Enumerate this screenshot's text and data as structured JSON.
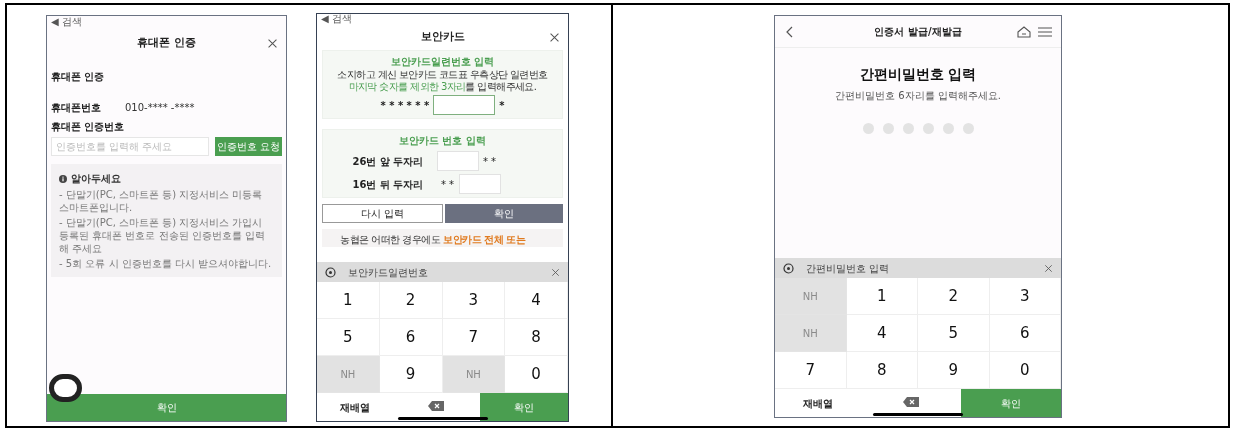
{
  "phone_verification": {
    "status_bar": "◀ 검색",
    "title": "휴대폰 인증",
    "section_title": "휴대폰 인증",
    "phone_label": "휴대폰번호",
    "phone_value": "010-**** -****",
    "code_label": "휴대폰 인증번호",
    "code_field": {
      "placeholder": "인증번호를 입력해 주세요"
    },
    "request_button": "인증번호 요청",
    "notice": {
      "title": "알아두세요",
      "items": [
        "- 단말기(PC, 스마트폰 등) 지정서비스 미등록 스마트폰입니다.",
        "- 단말기(PC, 스마트폰 등) 지정서비스 가입시 등록된 휴대폰 번호로 전송된 인증번호를 입력해 주세요",
        "- 5회 오류 시 인증번호를 다시 받으셔야합니다."
      ]
    },
    "confirm_button": "확인"
  },
  "security_card": {
    "status_bar": "◀ 검색",
    "title": "보안카드",
    "serial_section": {
      "title": "보안카드일련번호 입력",
      "line1": "소지하고 계신 보안카드 코드표 우측상단 일련번호",
      "line2_highlight": "마지막 숫자를 제외한 3자리",
      "line2_rest": "를 입력해주세요.",
      "masked_prefix": "* * * * * *",
      "masked_suffix": "*"
    },
    "number_section": {
      "title": "보안카드 번호 입력",
      "rows": [
        {
          "label": "26번 앞 두자리",
          "mask": "* *",
          "kind": "suffix"
        },
        {
          "label": "16번 뒤 두자리",
          "mask": "* *",
          "kind": "prefix"
        }
      ]
    },
    "buttons": [
      {
        "label": "다시 입력",
        "kind": "outline"
      },
      {
        "label": "확인",
        "kind": "filled"
      }
    ],
    "notice_plain": "농협은 어떠한 경우에도",
    "notice_highlight": "보안카드 전체 또는",
    "keypad": {
      "title": "보안카드일련번호",
      "keys": [
        {
          "kind": "digit",
          "label": "1"
        },
        {
          "kind": "digit",
          "label": "2"
        },
        {
          "kind": "digit",
          "label": "3"
        },
        {
          "kind": "digit",
          "label": "4"
        },
        {
          "kind": "digit",
          "label": "5"
        },
        {
          "kind": "digit",
          "label": "6"
        },
        {
          "kind": "digit",
          "label": "7"
        },
        {
          "kind": "digit",
          "label": "8"
        },
        {
          "kind": "logo",
          "label": "NH"
        },
        {
          "kind": "digit",
          "label": "9"
        },
        {
          "kind": "logo",
          "label": "NH"
        },
        {
          "kind": "digit",
          "label": "0"
        }
      ],
      "shuffle_button": "재배열",
      "confirm_button": "확인"
    }
  },
  "simple_password": {
    "title": "인증서 발급/재발급",
    "heading": "간편비밀번호 입력",
    "subtitle": "간편비밀번호 6자리를 입력해주세요.",
    "keypad": {
      "title": "간편비밀번호 입력",
      "keys": [
        {
          "kind": "logo",
          "label": "NH"
        },
        {
          "kind": "digit",
          "label": "1"
        },
        {
          "kind": "digit",
          "label": "2"
        },
        {
          "kind": "digit",
          "label": "3"
        },
        {
          "kind": "logo",
          "label": "NH"
        },
        {
          "kind": "digit",
          "label": "4"
        },
        {
          "kind": "digit",
          "label": "5"
        },
        {
          "kind": "digit",
          "label": "6"
        },
        {
          "kind": "digit",
          "label": "7"
        },
        {
          "kind": "digit",
          "label": "8"
        },
        {
          "kind": "digit",
          "label": "9"
        },
        {
          "kind": "digit",
          "label": "0"
        }
      ],
      "shuffle_button": "재배열",
      "confirm_button": "확인"
    }
  }
}
